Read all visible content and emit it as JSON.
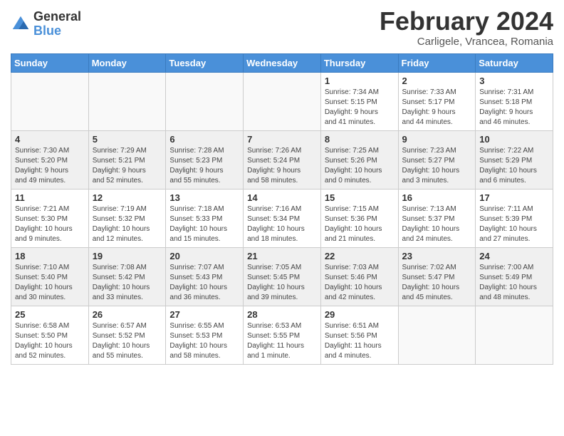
{
  "header": {
    "logo_general": "General",
    "logo_blue": "Blue",
    "month_title": "February 2024",
    "subtitle": "Carligele, Vrancea, Romania"
  },
  "columns": [
    "Sunday",
    "Monday",
    "Tuesday",
    "Wednesday",
    "Thursday",
    "Friday",
    "Saturday"
  ],
  "weeks": [
    [
      {
        "day": "",
        "info": ""
      },
      {
        "day": "",
        "info": ""
      },
      {
        "day": "",
        "info": ""
      },
      {
        "day": "",
        "info": ""
      },
      {
        "day": "1",
        "info": "Sunrise: 7:34 AM\nSunset: 5:15 PM\nDaylight: 9 hours\nand 41 minutes."
      },
      {
        "day": "2",
        "info": "Sunrise: 7:33 AM\nSunset: 5:17 PM\nDaylight: 9 hours\nand 44 minutes."
      },
      {
        "day": "3",
        "info": "Sunrise: 7:31 AM\nSunset: 5:18 PM\nDaylight: 9 hours\nand 46 minutes."
      }
    ],
    [
      {
        "day": "4",
        "info": "Sunrise: 7:30 AM\nSunset: 5:20 PM\nDaylight: 9 hours\nand 49 minutes."
      },
      {
        "day": "5",
        "info": "Sunrise: 7:29 AM\nSunset: 5:21 PM\nDaylight: 9 hours\nand 52 minutes."
      },
      {
        "day": "6",
        "info": "Sunrise: 7:28 AM\nSunset: 5:23 PM\nDaylight: 9 hours\nand 55 minutes."
      },
      {
        "day": "7",
        "info": "Sunrise: 7:26 AM\nSunset: 5:24 PM\nDaylight: 9 hours\nand 58 minutes."
      },
      {
        "day": "8",
        "info": "Sunrise: 7:25 AM\nSunset: 5:26 PM\nDaylight: 10 hours\nand 0 minutes."
      },
      {
        "day": "9",
        "info": "Sunrise: 7:23 AM\nSunset: 5:27 PM\nDaylight: 10 hours\nand 3 minutes."
      },
      {
        "day": "10",
        "info": "Sunrise: 7:22 AM\nSunset: 5:29 PM\nDaylight: 10 hours\nand 6 minutes."
      }
    ],
    [
      {
        "day": "11",
        "info": "Sunrise: 7:21 AM\nSunset: 5:30 PM\nDaylight: 10 hours\nand 9 minutes."
      },
      {
        "day": "12",
        "info": "Sunrise: 7:19 AM\nSunset: 5:32 PM\nDaylight: 10 hours\nand 12 minutes."
      },
      {
        "day": "13",
        "info": "Sunrise: 7:18 AM\nSunset: 5:33 PM\nDaylight: 10 hours\nand 15 minutes."
      },
      {
        "day": "14",
        "info": "Sunrise: 7:16 AM\nSunset: 5:34 PM\nDaylight: 10 hours\nand 18 minutes."
      },
      {
        "day": "15",
        "info": "Sunrise: 7:15 AM\nSunset: 5:36 PM\nDaylight: 10 hours\nand 21 minutes."
      },
      {
        "day": "16",
        "info": "Sunrise: 7:13 AM\nSunset: 5:37 PM\nDaylight: 10 hours\nand 24 minutes."
      },
      {
        "day": "17",
        "info": "Sunrise: 7:11 AM\nSunset: 5:39 PM\nDaylight: 10 hours\nand 27 minutes."
      }
    ],
    [
      {
        "day": "18",
        "info": "Sunrise: 7:10 AM\nSunset: 5:40 PM\nDaylight: 10 hours\nand 30 minutes."
      },
      {
        "day": "19",
        "info": "Sunrise: 7:08 AM\nSunset: 5:42 PM\nDaylight: 10 hours\nand 33 minutes."
      },
      {
        "day": "20",
        "info": "Sunrise: 7:07 AM\nSunset: 5:43 PM\nDaylight: 10 hours\nand 36 minutes."
      },
      {
        "day": "21",
        "info": "Sunrise: 7:05 AM\nSunset: 5:45 PM\nDaylight: 10 hours\nand 39 minutes."
      },
      {
        "day": "22",
        "info": "Sunrise: 7:03 AM\nSunset: 5:46 PM\nDaylight: 10 hours\nand 42 minutes."
      },
      {
        "day": "23",
        "info": "Sunrise: 7:02 AM\nSunset: 5:47 PM\nDaylight: 10 hours\nand 45 minutes."
      },
      {
        "day": "24",
        "info": "Sunrise: 7:00 AM\nSunset: 5:49 PM\nDaylight: 10 hours\nand 48 minutes."
      }
    ],
    [
      {
        "day": "25",
        "info": "Sunrise: 6:58 AM\nSunset: 5:50 PM\nDaylight: 10 hours\nand 52 minutes."
      },
      {
        "day": "26",
        "info": "Sunrise: 6:57 AM\nSunset: 5:52 PM\nDaylight: 10 hours\nand 55 minutes."
      },
      {
        "day": "27",
        "info": "Sunrise: 6:55 AM\nSunset: 5:53 PM\nDaylight: 10 hours\nand 58 minutes."
      },
      {
        "day": "28",
        "info": "Sunrise: 6:53 AM\nSunset: 5:55 PM\nDaylight: 11 hours\nand 1 minute."
      },
      {
        "day": "29",
        "info": "Sunrise: 6:51 AM\nSunset: 5:56 PM\nDaylight: 11 hours\nand 4 minutes."
      },
      {
        "day": "",
        "info": ""
      },
      {
        "day": "",
        "info": ""
      }
    ]
  ]
}
